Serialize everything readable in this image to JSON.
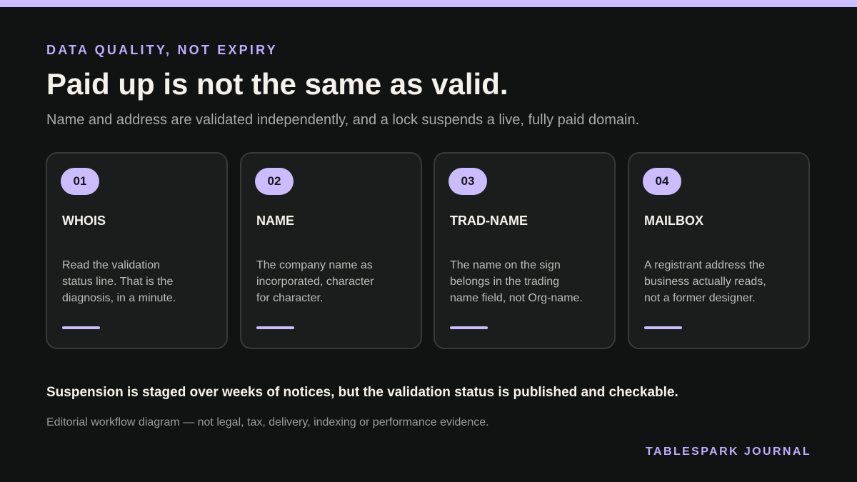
{
  "eyebrow": "DATA QUALITY, NOT EXPIRY",
  "title": "Paid up is not the same as valid.",
  "subtitle": "Name and address are validated independently, and a lock suspends a live, fully paid domain.",
  "cards": [
    {
      "number": "01",
      "title": "WHOIS",
      "lines": [
        "Read the validation",
        "status line. That is the",
        "diagnosis, in a minute."
      ]
    },
    {
      "number": "02",
      "title": "NAME",
      "lines": [
        "The company name as",
        "incorporated, character",
        "for character."
      ]
    },
    {
      "number": "03",
      "title": "TRAD-NAME",
      "lines": [
        "The name on the sign",
        "belongs in the trading",
        "name field, not Org-name."
      ]
    },
    {
      "number": "04",
      "title": "MAILBOX",
      "lines": [
        "A registrant address the",
        "business actually reads,",
        "not a former designer."
      ]
    }
  ],
  "statement": "Suspension is staged over weeks of notices, but the validation status is published and checkable.",
  "note": "Editorial workflow diagram — not legal, tax, delivery, indexing or performance evidence.",
  "brand": "TABLESPARK JOURNAL",
  "colors": {
    "background": "#111212",
    "accent": "#cbbcff",
    "card": "#1b1d1d",
    "card_border": "#373a39"
  }
}
